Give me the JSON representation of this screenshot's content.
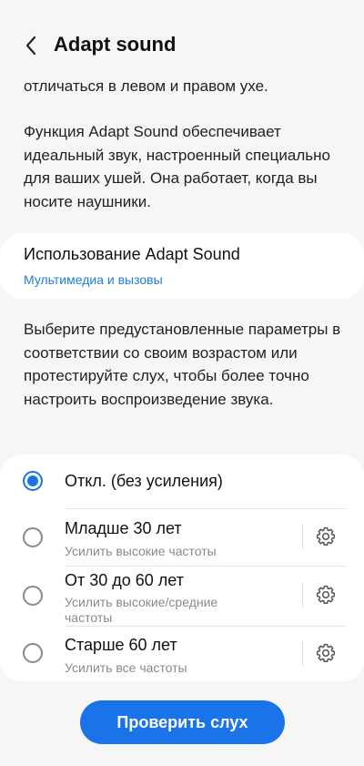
{
  "header": {
    "title": "Adapt sound"
  },
  "intro": {
    "partial_text": "отличаться в левом и правом ухе.",
    "description": "Функция Adapt Sound обеспечивает идеальный звук, настроенный специально для ваших ушей. Она работает, когда вы носите наушники."
  },
  "usage": {
    "title": "Использование Adapt Sound",
    "value": "Мультимедиа и вызовы"
  },
  "presets": {
    "description": "Выберите предустановленные параметры в соответствии со своим возрастом или протестируйте слух, чтобы более точно настроить воспроизведение звука.",
    "options": [
      {
        "label": "Откл. (без усиления)",
        "selected": true
      },
      {
        "label": "Младше 30 лет",
        "sub": "Усилить высокие частоты",
        "selected": false
      },
      {
        "label": "От 30 до 60 лет",
        "sub": "Усилить высокие/средние частоты",
        "selected": false
      },
      {
        "label": "Старше 60 лет",
        "sub": "Усилить все частоты",
        "selected": false
      }
    ]
  },
  "actions": {
    "check_hearing": "Проверить слух"
  },
  "icons": {
    "back": "chevron-left-icon",
    "settings": "gear-icon"
  },
  "colors": {
    "accent": "#1a73e8",
    "link": "#1f7ed8",
    "background": "#f6f6f6"
  }
}
